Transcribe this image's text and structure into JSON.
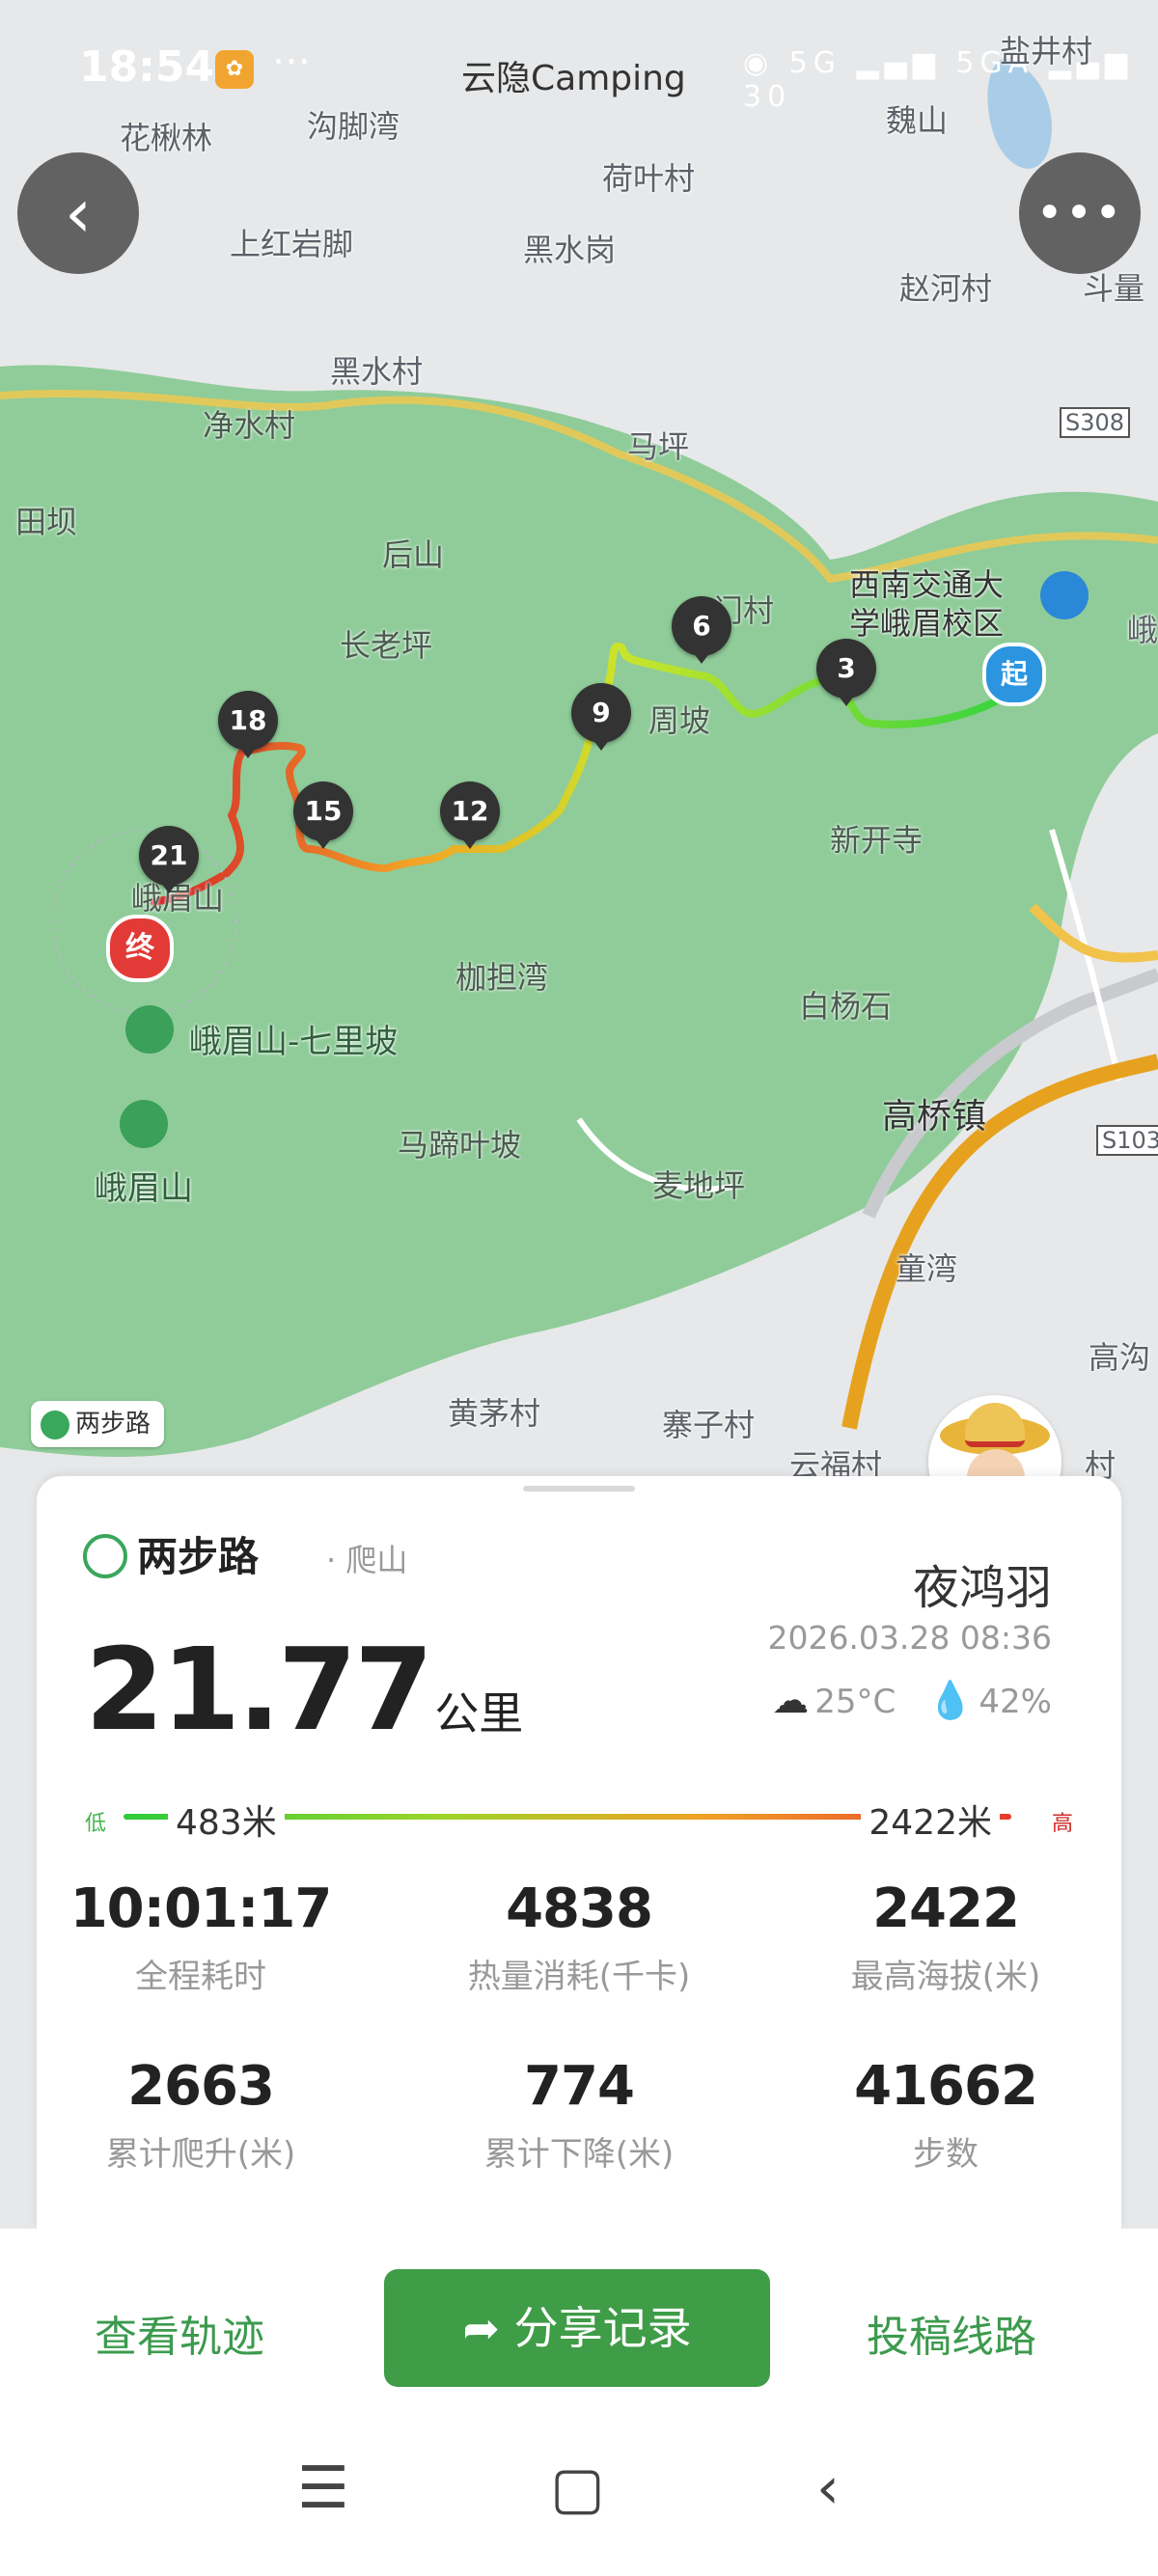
{
  "status_bar": {
    "time": "18:54",
    "app_title": "云隐Camping",
    "right_icons": "◉ 5G ▂▄▆ 5GA ▂▄▆ 30"
  },
  "map": {
    "places": [
      {
        "key": "huajiaolin",
        "text": "花楸林"
      },
      {
        "key": "goujiaowan",
        "text": "沟脚湾"
      },
      {
        "key": "heyecun",
        "text": "荷叶村"
      },
      {
        "key": "weishan",
        "text": "魏山"
      },
      {
        "key": "shanghongyanjiao",
        "text": "上红岩脚"
      },
      {
        "key": "heishuigang",
        "text": "黑水岗"
      },
      {
        "key": "zhaohecun",
        "text": "赵河村"
      },
      {
        "key": "douliang",
        "text": "斗量"
      },
      {
        "key": "heishuicun",
        "text": "黑水村"
      },
      {
        "key": "jingshuicun",
        "text": "净水村"
      },
      {
        "key": "maping",
        "text": "马坪"
      },
      {
        "key": "s308",
        "text": "S308"
      },
      {
        "key": "tianba",
        "text": "田坝"
      },
      {
        "key": "houshan",
        "text": "后山"
      },
      {
        "key": "swjtu",
        "text": "西南交通大\n学峨眉校区"
      },
      {
        "key": "e",
        "text": "峨"
      },
      {
        "key": "zhanglaoping",
        "text": "长老坪"
      },
      {
        "key": "menmencun",
        "text": "门村"
      },
      {
        "key": "zhoupo",
        "text": "周坡"
      },
      {
        "key": "xinkaisi",
        "text": "新开寺"
      },
      {
        "key": "emeishan_peak",
        "text": "峨眉山"
      },
      {
        "key": "jiadanwan",
        "text": "枷担湾"
      },
      {
        "key": "baiyangshi",
        "text": "白杨石"
      },
      {
        "key": "qiliipo",
        "text": "峨眉山-七里坡"
      },
      {
        "key": "gaoqiaozhen",
        "text": "高桥镇"
      },
      {
        "key": "s103",
        "text": "S103"
      },
      {
        "key": "matiyepo",
        "text": "马蹄叶坡"
      },
      {
        "key": "emeishan_poi",
        "text": "峨眉山"
      },
      {
        "key": "maidiping",
        "text": "麦地坪"
      },
      {
        "key": "tongwan",
        "text": "童湾"
      },
      {
        "key": "gaogou",
        "text": "高沟"
      },
      {
        "key": "huangmaocun",
        "text": "黄茅村"
      },
      {
        "key": "zhaizicun",
        "text": "寨子村"
      },
      {
        "key": "yunfucun",
        "text": "云福村"
      },
      {
        "key": "cun",
        "text": "村"
      },
      {
        "key": "gaojingcun",
        "text": "盐井村"
      }
    ],
    "markers": [
      "3",
      "6",
      "9",
      "12",
      "15",
      "18",
      "21"
    ],
    "start_label": "起",
    "end_label": "终",
    "watermark": "两步路"
  },
  "card": {
    "brand": "两步路",
    "activity": "· 爬山",
    "distance_value": "21.77",
    "distance_unit": "公里",
    "username": "夜鸿羽",
    "datetime": "2026.03.28 08:36",
    "temperature": "25°C",
    "humidity": "42%",
    "elevation": {
      "low_label": "低",
      "low_value": "483米",
      "high_value": "2422米",
      "high_label": "高"
    },
    "stats": [
      {
        "value": "10:01:17",
        "label": "全程耗时"
      },
      {
        "value": "4838",
        "label": "热量消耗(千卡)"
      },
      {
        "value": "2422",
        "label": "最高海拔(米)"
      },
      {
        "value": "2663",
        "label": "累计爬升(米)"
      },
      {
        "value": "774",
        "label": "累计下降(米)"
      },
      {
        "value": "41662",
        "label": "步数"
      }
    ]
  },
  "actions": {
    "view_track": "查看轨迹",
    "share": "分享记录",
    "submit_route": "投稿线路"
  },
  "colors": {
    "brand_green": "#3f9c47",
    "map_green": "#8fcc99",
    "track_low": "#2ecb3a",
    "track_high": "#e73a2d"
  }
}
